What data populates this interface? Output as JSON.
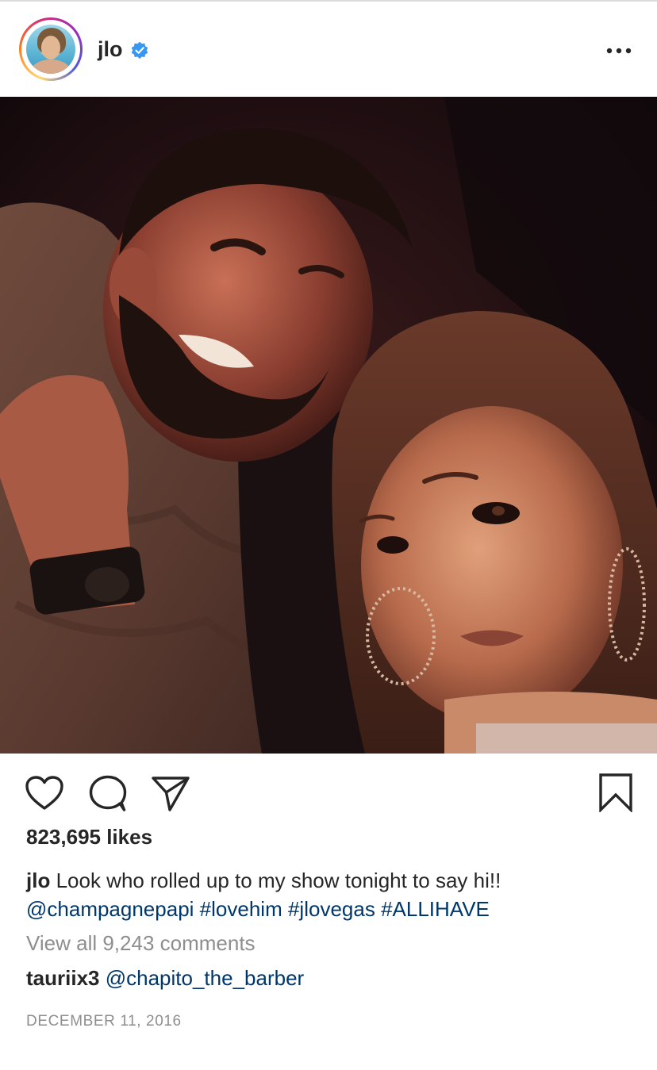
{
  "post": {
    "username": "jlo",
    "verified_icon": "verified-badge-icon",
    "more_icon": "more-options-icon",
    "likes": "823,695 likes",
    "caption": {
      "author": "jlo",
      "text": "Look who rolled up to my show tonight to say hi!!",
      "tags": [
        "@champagnepapi",
        "#lovehim",
        "#jlovegas",
        "#ALLIHAVE"
      ]
    },
    "view_comments": "View all 9,243 comments",
    "comment": {
      "author": "tauriix3",
      "mention": "@chapito_the_barber"
    },
    "date": "DECEMBER 11, 2016"
  },
  "actions": {
    "icons": [
      "heart-icon",
      "comment-icon",
      "share-icon",
      "bookmark-icon"
    ]
  },
  "colors": {
    "text": "#262626",
    "link": "#00376b",
    "secondary": "#8e8e8e",
    "verified": "#3897f0",
    "divider": "#dbdbdb"
  }
}
